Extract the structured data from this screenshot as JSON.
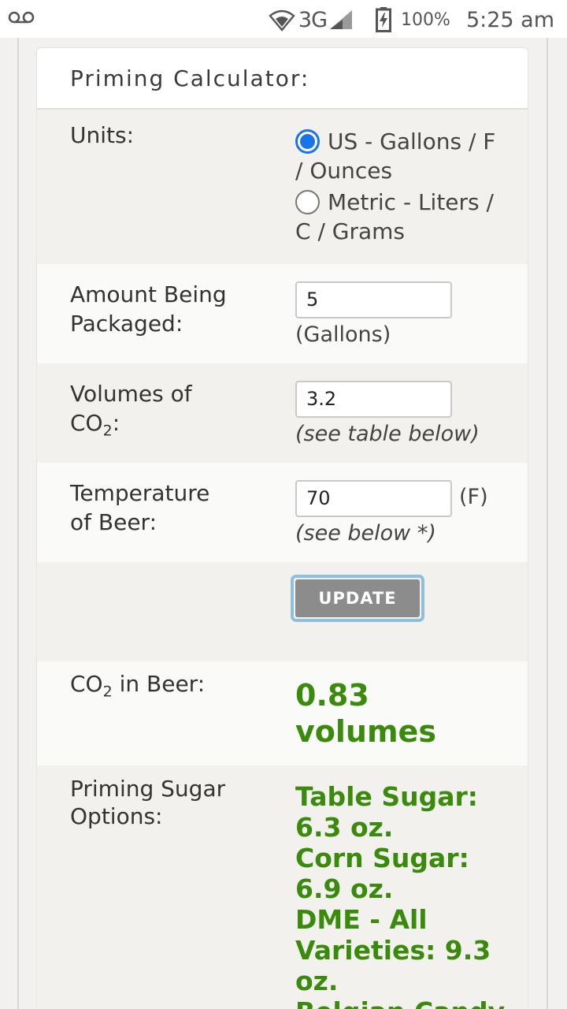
{
  "statusbar": {
    "network": "3G",
    "battery_pct": "100%",
    "time": "5:25 am",
    "icons": [
      "voicemail-icon",
      "wifi-signal-icon",
      "cell-signal-icon",
      "battery-charging-icon"
    ]
  },
  "card": {
    "title": "Priming Calculator:"
  },
  "units": {
    "label": "Units:",
    "options": [
      {
        "line1": "US - Gallons / F",
        "line2": "/ Ounces",
        "selected": true
      },
      {
        "line1": "Metric - Liters /",
        "line2": "C / Grams",
        "selected": false
      }
    ]
  },
  "amount": {
    "label1": "Amount Being",
    "label2": "Packaged:",
    "value": "5",
    "unit": "(Gallons)"
  },
  "volumes": {
    "label1": "Volumes of",
    "label2_pre": "CO",
    "label2_sub": "2",
    "label2_post": ":",
    "value": "3.2",
    "hint": "(see table below)"
  },
  "temperature": {
    "label1": "Temperature",
    "label2": "of Beer:",
    "value": "70",
    "unit": "(F)",
    "hint": "(see below *)"
  },
  "update_button": "UPDATE",
  "co2_in_beer": {
    "label_pre": "CO",
    "label_sub": "2",
    "label_post": " in Beer:",
    "value_line1": "0.83",
    "value_line2": "volumes"
  },
  "priming_sugar": {
    "label1": "Priming Sugar",
    "label2": "Options:",
    "lines": [
      "Table Sugar:",
      "6.3 oz.",
      "Corn Sugar:",
      "6.9 oz.",
      "DME - All",
      "Varieties: 9.3",
      "oz.",
      "Belgian Candy"
    ]
  },
  "colors": {
    "accent_radio": "#1a73e8",
    "result_green": "#3a8a0c",
    "button_gray": "#8c8c8c"
  }
}
